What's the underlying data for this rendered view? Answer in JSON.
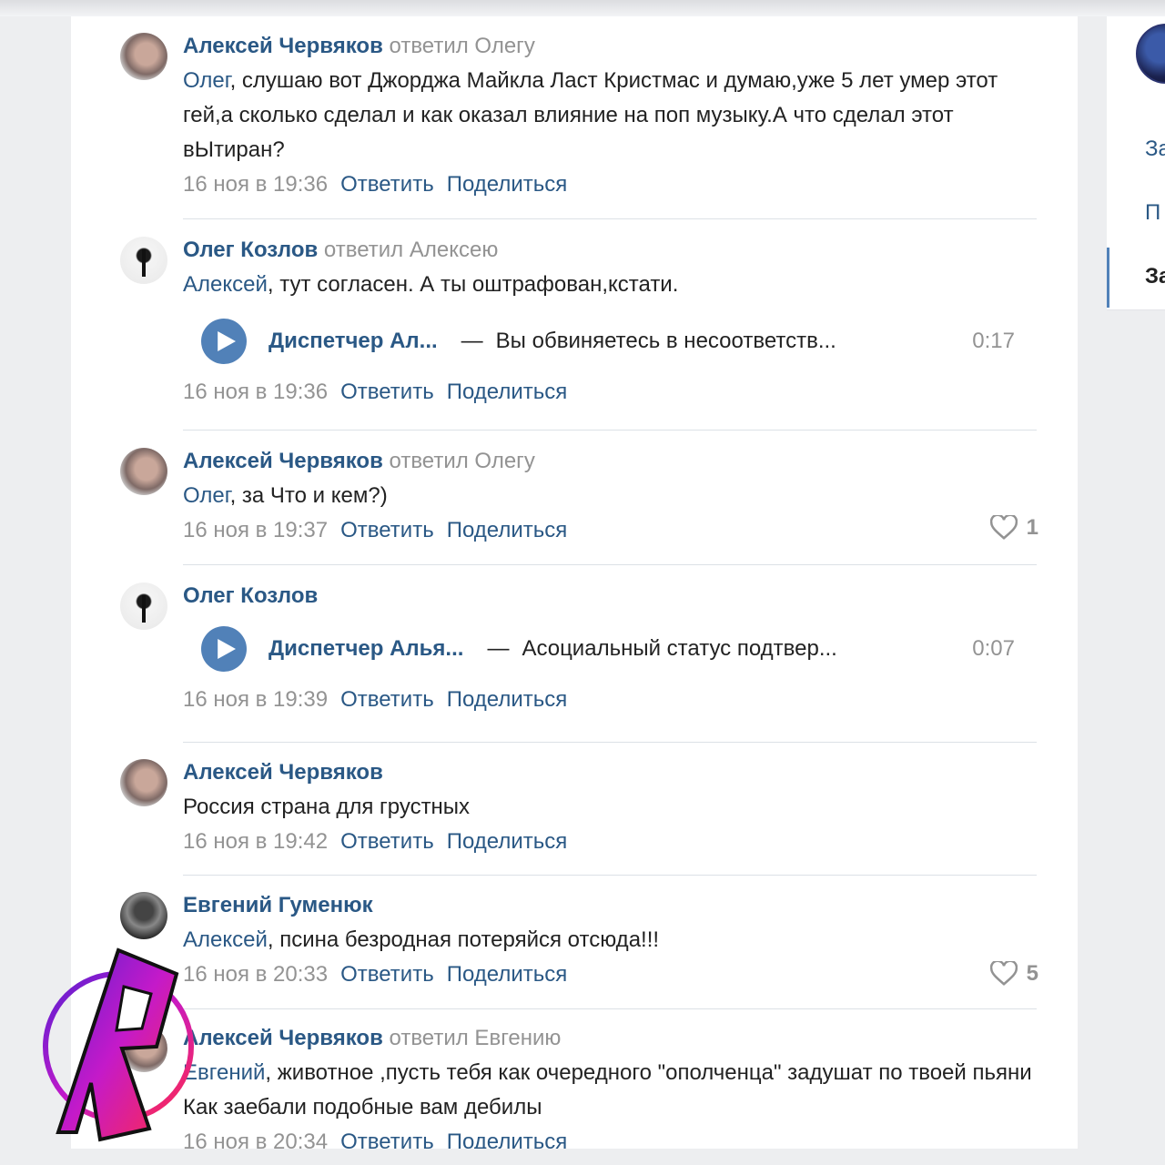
{
  "comments": [
    {
      "author": "Алексей Червяков",
      "replied": "ответил Олегу",
      "mention": "Олег",
      "text": ", слушаю вот Джорджа Майкла Ласт Кристмас и думаю,уже 5 лет умер этот гей,а сколько сделал и как оказал влияние на поп музыку.А что сделал этот вЫтиран?",
      "time": "16 ноя в 19:36"
    },
    {
      "author": "Олег Козлов",
      "replied": "ответил Алексею",
      "mention": "Алексей",
      "text": ", тут согласен. А ты оштрафован,кстати.",
      "audio": {
        "artist": "Диспетчер Ал...",
        "dash": "—",
        "track": "Вы обвиняетесь в несоответств...",
        "duration": "0:17"
      },
      "time": "16 ноя в 19:36"
    },
    {
      "author": "Алексей Червяков",
      "replied": "ответил Олегу",
      "mention": "Олег",
      "text": ", за Что и кем?)",
      "time": "16 ноя в 19:37",
      "likes": "1"
    },
    {
      "author": "Олег Козлов",
      "audio": {
        "artist": "Диспетчер Алья...",
        "dash": "—",
        "track": "Асоциальный статус подтвер...",
        "duration": "0:07"
      },
      "time": "16 ноя в 19:39"
    },
    {
      "author": "Алексей Червяков",
      "text": "Россия страна для грустных",
      "time": "16 ноя в 19:42"
    },
    {
      "author": "Евгений Гуменюк",
      "mention": "Алексей",
      "text": ", псина безродная потеряйся отсюда!!!",
      "time": "16 ноя в 20:33",
      "likes": "5"
    },
    {
      "author": "Алексей Червяков",
      "replied": "ответил Евгению",
      "mention": "Евгений",
      "text": ", животное ,пусть тебя как очередного \"ополченца\" задушат по твоей пьяни Как заебали подобные вам дебилы",
      "time": "16 ноя в 20:34"
    }
  ],
  "actions": {
    "reply": "Ответить",
    "share": "Поделиться"
  },
  "sidebar": {
    "items": [
      "За",
      "П",
      "За"
    ]
  },
  "colors": {
    "link": "#2a5885",
    "muted": "#939393",
    "accent": "#5181b8"
  },
  "watermark_logo": "R"
}
